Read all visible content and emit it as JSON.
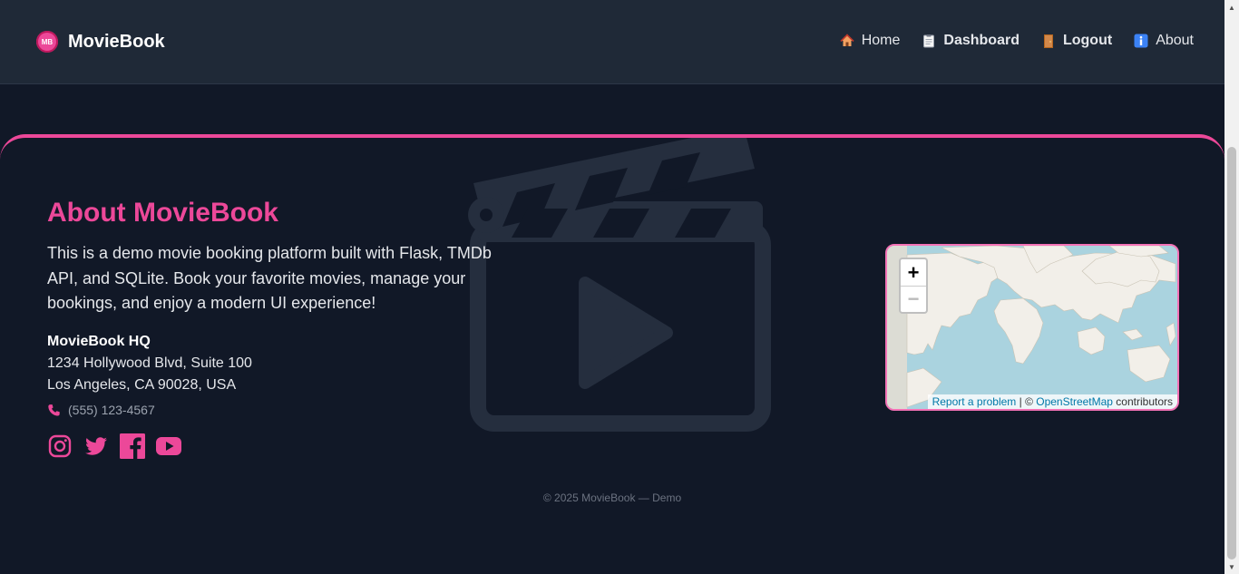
{
  "navbar": {
    "brand_logo_text": "MB",
    "brand_name": "MovieBook",
    "links": [
      {
        "label": "Home",
        "icon": "house-icon"
      },
      {
        "label": "Dashboard",
        "icon": "clipboard-icon"
      },
      {
        "label": "Logout",
        "icon": "door-icon"
      },
      {
        "label": "About",
        "icon": "info-icon"
      }
    ]
  },
  "about": {
    "title": "About MovieBook",
    "description": "This is a demo movie booking platform built with Flask, TMDb API, and SQLite. Book your favorite movies, manage your bookings, and enjoy a modern UI experience!",
    "hq_name": "MovieBook HQ",
    "address_line1": "1234 Hollywood Blvd, Suite 100",
    "address_line2": "Los Angeles, CA 90028, USA",
    "phone": "(555) 123-4567",
    "socials": [
      "instagram-icon",
      "twitter-icon",
      "facebook-icon",
      "youtube-icon"
    ]
  },
  "map": {
    "zoom_in": "+",
    "zoom_out": "−",
    "attribution_report": "Report a problem",
    "attribution_sep": " | © ",
    "attribution_osm": "OpenStreetMap",
    "attribution_tail": " contributors"
  },
  "footer": {
    "text": "© 2025 MovieBook — Demo"
  },
  "colors": {
    "accent": "#ec4899",
    "background": "#111827",
    "navbar": "#1f2937"
  }
}
